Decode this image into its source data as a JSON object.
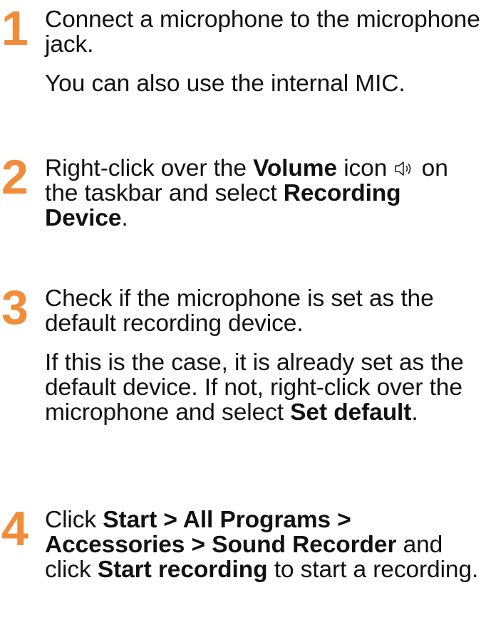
{
  "accent_color": "#f08c3a",
  "steps": [
    {
      "number": "1",
      "line1": "Connect a microphone to the microphone jack.",
      "line2": "You can also use the internal MIC."
    },
    {
      "number": "2",
      "t1": "Right-click over the ",
      "b1": "Volume",
      "t2": " icon ",
      "icon": "speaker-volume-icon",
      "t3": " on the taskbar and select ",
      "b2": "Recording Device",
      "t4": "."
    },
    {
      "number": "3",
      "line1": "Check if the microphone is set as the default recording device.",
      "t1": "If this is the case, it is already set as the default device. If not, right-click over the microphone and select ",
      "b1": "Set default",
      "t2": "."
    },
    {
      "number": "4",
      "t1": "Click ",
      "b1": "Start > All Programs > Accessories > Sound Recorder",
      "t2": " and click ",
      "b2": "Start recording",
      "t3": " to start a recording."
    }
  ]
}
